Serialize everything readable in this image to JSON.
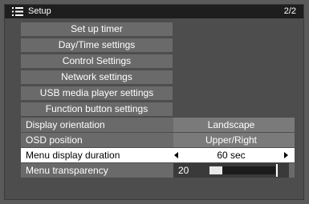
{
  "header": {
    "title": "Setup",
    "page": "2/2"
  },
  "menu_buttons": [
    "Set up timer",
    "Day/Time settings",
    "Control Settings",
    "Network settings",
    "USB media player settings",
    "Function button settings"
  ],
  "settings": {
    "display_orientation": {
      "label": "Display orientation",
      "value": "Landscape"
    },
    "osd_position": {
      "label": "OSD position",
      "value": "Upper/Right"
    },
    "menu_display_duration": {
      "label": "Menu display duration",
      "value": "60 sec"
    },
    "menu_transparency": {
      "label": "Menu transparency",
      "value": "20",
      "level": 0.2
    }
  },
  "icons": {
    "header": "list-menu-icon",
    "prev": "left-arrow-icon",
    "next": "right-arrow-icon"
  },
  "colors": {
    "background": "#5a5a5a",
    "panel": "#4d4d4d",
    "header": "#1e1e1e",
    "item": "#6a6a6a",
    "selected": "#ffffff"
  }
}
